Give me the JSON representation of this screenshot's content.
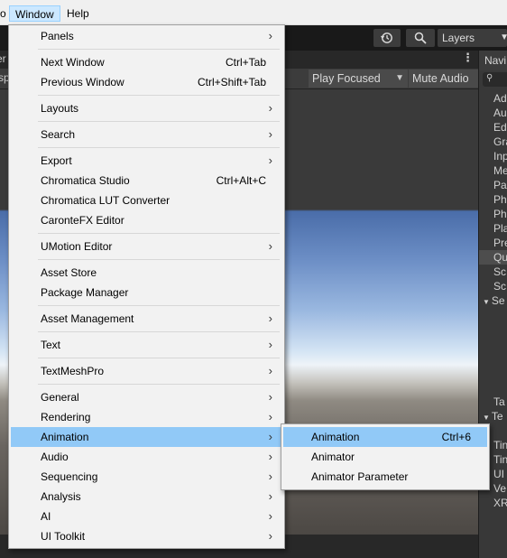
{
  "menubar": {
    "clipped_item": "o",
    "items": [
      {
        "label": "Window"
      },
      {
        "label": "Help"
      }
    ]
  },
  "toolbar": {
    "layers_label": "Layers",
    "dropdown_glyph": "▼",
    "history_icon": "history-icon",
    "search_icon": "search-icon"
  },
  "game_view": {
    "tab_clipped": "er",
    "clipped_text": "sp",
    "play_focused_label": "Play Focused",
    "mute_audio_label": "Mute Audio",
    "kebab_glyph": "⋮"
  },
  "right_panel": {
    "title": "Navi",
    "items": [
      {
        "label": "Ad",
        "kind": "item",
        "selected": false
      },
      {
        "label": "Au",
        "kind": "item",
        "selected": false
      },
      {
        "label": "Ed",
        "kind": "item",
        "selected": false
      },
      {
        "label": "Gra",
        "kind": "item",
        "selected": false
      },
      {
        "label": "Inp",
        "kind": "item",
        "selected": false
      },
      {
        "label": "Me",
        "kind": "item",
        "selected": false
      },
      {
        "label": "Pa",
        "kind": "item",
        "selected": false
      },
      {
        "label": "Ph",
        "kind": "item",
        "selected": false
      },
      {
        "label": "Ph",
        "kind": "item",
        "selected": false
      },
      {
        "label": "Pla",
        "kind": "item",
        "selected": false
      },
      {
        "label": "Pre",
        "kind": "item",
        "selected": false
      },
      {
        "label": "Qu",
        "kind": "item",
        "selected": true
      },
      {
        "label": "Sc",
        "kind": "item",
        "selected": false
      },
      {
        "label": "Sc",
        "kind": "item",
        "selected": false
      },
      {
        "label": "Se",
        "kind": "group",
        "selected": false
      },
      {
        "label": "",
        "kind": "blank",
        "selected": false
      },
      {
        "label": "",
        "kind": "blank",
        "selected": false
      },
      {
        "label": "",
        "kind": "blank",
        "selected": false
      },
      {
        "label": "",
        "kind": "blank",
        "selected": false
      },
      {
        "label": "",
        "kind": "blank",
        "selected": false
      },
      {
        "label": "",
        "kind": "blank",
        "selected": false
      },
      {
        "label": "Ta",
        "kind": "item",
        "selected": false
      },
      {
        "label": "Te",
        "kind": "group",
        "selected": false
      },
      {
        "label": "",
        "kind": "blank",
        "selected": false
      },
      {
        "label": "Tin",
        "kind": "item",
        "selected": false
      },
      {
        "label": "Tin",
        "kind": "item",
        "selected": false
      },
      {
        "label": "UI",
        "kind": "item",
        "selected": false
      },
      {
        "label": "Ve",
        "kind": "item",
        "selected": false
      },
      {
        "label": "XR",
        "kind": "item",
        "selected": false
      }
    ]
  },
  "window_menu": {
    "items": [
      {
        "label": "Panels",
        "shortcut": "",
        "submenu": true
      },
      {
        "separator": true
      },
      {
        "label": "Next Window",
        "shortcut": "Ctrl+Tab",
        "submenu": false
      },
      {
        "label": "Previous Window",
        "shortcut": "Ctrl+Shift+Tab",
        "submenu": false
      },
      {
        "separator": true
      },
      {
        "label": "Layouts",
        "shortcut": "",
        "submenu": true
      },
      {
        "separator": true
      },
      {
        "label": "Search",
        "shortcut": "",
        "submenu": true
      },
      {
        "separator": true
      },
      {
        "label": "Export",
        "shortcut": "",
        "submenu": true
      },
      {
        "label": "Chromatica Studio",
        "shortcut": "Ctrl+Alt+C",
        "submenu": false
      },
      {
        "label": "Chromatica LUT Converter",
        "shortcut": "",
        "submenu": false
      },
      {
        "label": "CaronteFX Editor",
        "shortcut": "",
        "submenu": false
      },
      {
        "separator": true
      },
      {
        "label": "UMotion Editor",
        "shortcut": "",
        "submenu": true
      },
      {
        "separator": true
      },
      {
        "label": "Asset Store",
        "shortcut": "",
        "submenu": false
      },
      {
        "label": "Package Manager",
        "shortcut": "",
        "submenu": false
      },
      {
        "separator": true
      },
      {
        "label": "Asset Management",
        "shortcut": "",
        "submenu": true
      },
      {
        "separator": true
      },
      {
        "label": "Text",
        "shortcut": "",
        "submenu": true
      },
      {
        "separator": true
      },
      {
        "label": "TextMeshPro",
        "shortcut": "",
        "submenu": true
      },
      {
        "separator": true
      },
      {
        "label": "General",
        "shortcut": "",
        "submenu": true
      },
      {
        "label": "Rendering",
        "shortcut": "",
        "submenu": true
      },
      {
        "label": "Animation",
        "shortcut": "",
        "submenu": true,
        "highlighted": true
      },
      {
        "label": "Audio",
        "shortcut": "",
        "submenu": true
      },
      {
        "label": "Sequencing",
        "shortcut": "",
        "submenu": true
      },
      {
        "label": "Analysis",
        "shortcut": "",
        "submenu": true
      },
      {
        "label": "AI",
        "shortcut": "",
        "submenu": true
      },
      {
        "label": "UI Toolkit",
        "shortcut": "",
        "submenu": true
      }
    ],
    "arrow_glyph": "›"
  },
  "animation_submenu": {
    "items": [
      {
        "label": "Animation",
        "shortcut": "Ctrl+6",
        "highlighted": true
      },
      {
        "label": "Animator",
        "shortcut": ""
      },
      {
        "label": "Animator Parameter",
        "shortcut": ""
      }
    ]
  }
}
